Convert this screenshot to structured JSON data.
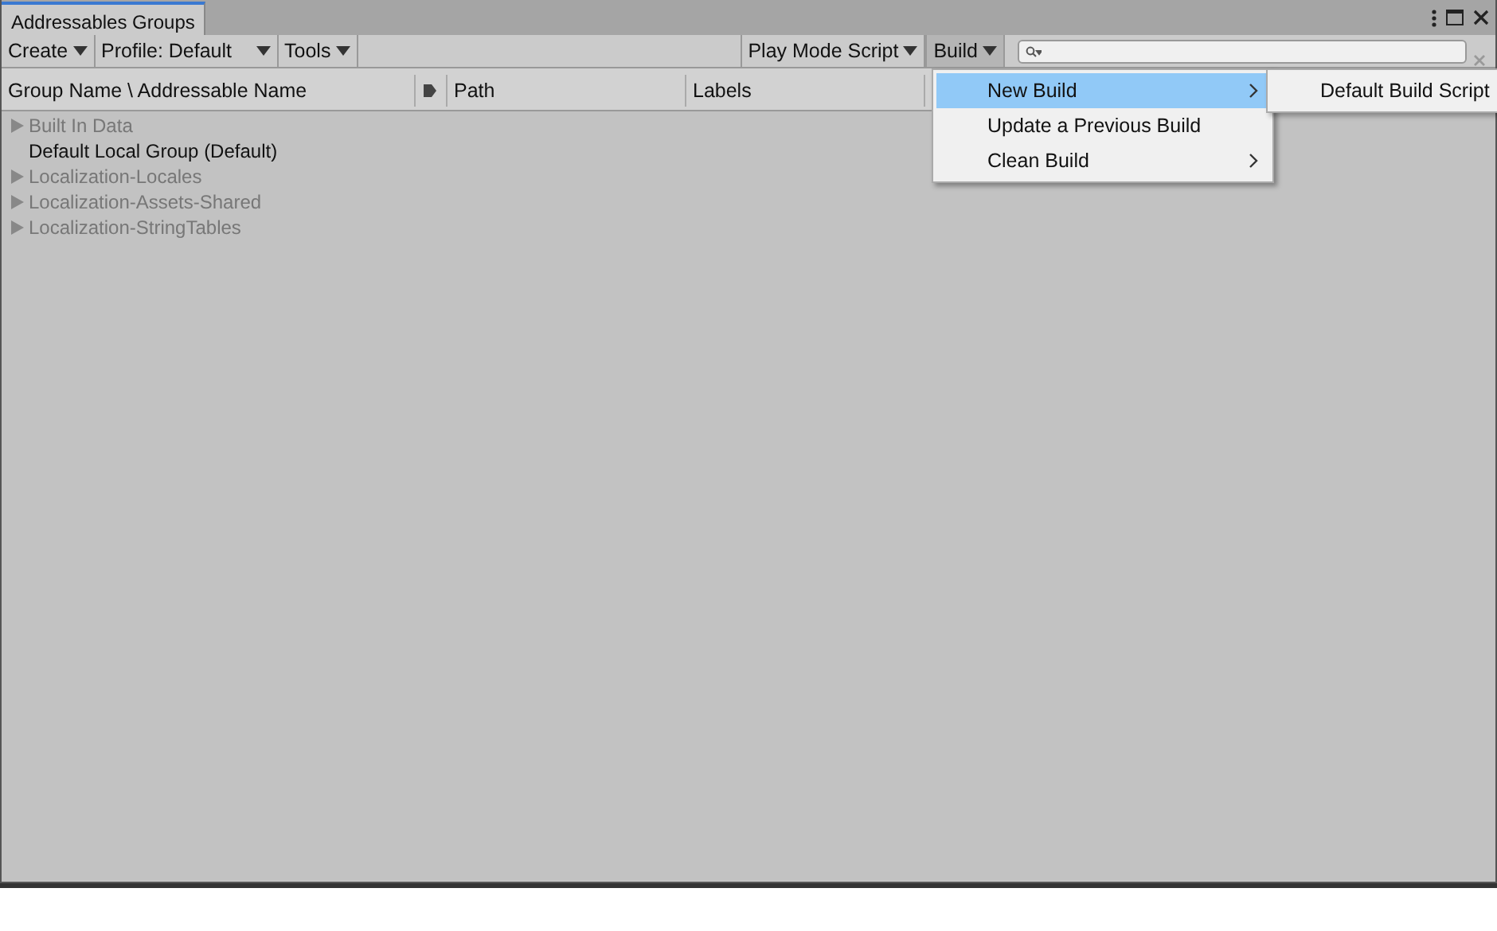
{
  "window": {
    "tab": "Addressables Groups"
  },
  "toolbar_left": [
    {
      "label": "Create",
      "kind": "dropdown"
    },
    {
      "label": "Profile: Default",
      "kind": "wide-dropdown"
    },
    {
      "label": "Tools",
      "kind": "dropdown"
    }
  ],
  "toolbar_right": [
    {
      "label": "Play Mode Script",
      "kind": "dropdown",
      "open": false
    },
    {
      "label": "Build",
      "kind": "dropdown",
      "open": true
    }
  ],
  "columns": [
    {
      "label": "Group Name \\ Addressable Name",
      "kind": "text"
    },
    {
      "kind": "icon"
    },
    {
      "label": "Path",
      "kind": "text"
    },
    {
      "label": "Labels",
      "kind": "text"
    }
  ],
  "groups": [
    {
      "name": "Built In Data",
      "expandable": true,
      "dimmed": true
    },
    {
      "name": "Default Local Group (Default)",
      "expandable": false,
      "dimmed": false
    },
    {
      "name": "Localization-Locales",
      "expandable": true,
      "dimmed": true
    },
    {
      "name": "Localization-Assets-Shared",
      "expandable": true,
      "dimmed": true
    },
    {
      "name": "Localization-StringTables",
      "expandable": true,
      "dimmed": true
    }
  ],
  "build_menu": [
    {
      "label": "New Build",
      "selected": true,
      "submenu": true
    },
    {
      "label": "Update a Previous Build",
      "selected": false,
      "submenu": false
    },
    {
      "label": "Clean Build",
      "selected": false,
      "submenu": true
    }
  ],
  "submenu": [
    {
      "label": "Default Build Script"
    }
  ]
}
